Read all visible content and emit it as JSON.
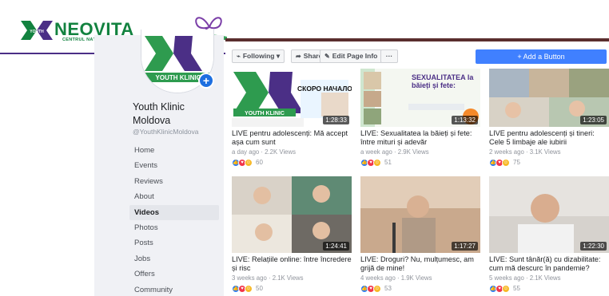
{
  "banner": {
    "brand": "NEOVITA",
    "subtitle": "CENTRUL NAȚIONAL DE RESURSE",
    "colors": {
      "green": "#12823f",
      "purple": "#7b3fa8"
    }
  },
  "page": {
    "name": "Youth Klinic Moldova",
    "handle": "@YouthKlinicMoldova",
    "avatar_text": "YOUTH KLINIC"
  },
  "nav": [
    {
      "label": "Home"
    },
    {
      "label": "Events"
    },
    {
      "label": "Reviews"
    },
    {
      "label": "About"
    },
    {
      "label": "Videos",
      "active": true
    },
    {
      "label": "Photos"
    },
    {
      "label": "Posts"
    },
    {
      "label": "Jobs"
    },
    {
      "label": "Offers"
    },
    {
      "label": "Community"
    }
  ],
  "toolbar": {
    "following": "Following",
    "share": "Share",
    "edit": "Edit Page Info",
    "more": "···",
    "add_button": "+ Add a Button"
  },
  "videos": [
    {
      "title": "LIVE pentru adolescenți: Mă accept așa cum sunt",
      "meta": "a day ago · 2.2K Views",
      "reactions": "60",
      "duration": "1:28:33",
      "thumb_text": "СКОРО НАЧАЛО..."
    },
    {
      "title": "LIVE: Sexualitatea la băieți și fete: între mituri și adevăr",
      "meta": "a week ago · 2.9K Views",
      "reactions": "51",
      "duration": "1:13:32",
      "thumb_text": "SEXUALITATEA la băieți și fete:"
    },
    {
      "title": "LIVE pentru adolescenți și tineri: Cele 5 limbaje ale iubirii",
      "meta": "2 weeks ago · 3.1K Views",
      "reactions": "75",
      "duration": "1:23:05"
    },
    {
      "title": "LIVE: Relațiile online: între încredere și risc",
      "meta": "3 weeks ago · 2.1K Views",
      "reactions": "50",
      "duration": "1:24:41"
    },
    {
      "title": "LIVE: Droguri? Nu, mulțumesc, am grijă de mine!",
      "meta": "4 weeks ago · 1.9K Views",
      "reactions": "53",
      "duration": "1:17:27"
    },
    {
      "title": "LIVE: Sunt tânăr(ă) cu dizabilitate: cum mă descurc în pandemie?",
      "meta": "5 weeks ago · 2.1K Views",
      "reactions": "55",
      "duration": "1:22:30"
    }
  ]
}
